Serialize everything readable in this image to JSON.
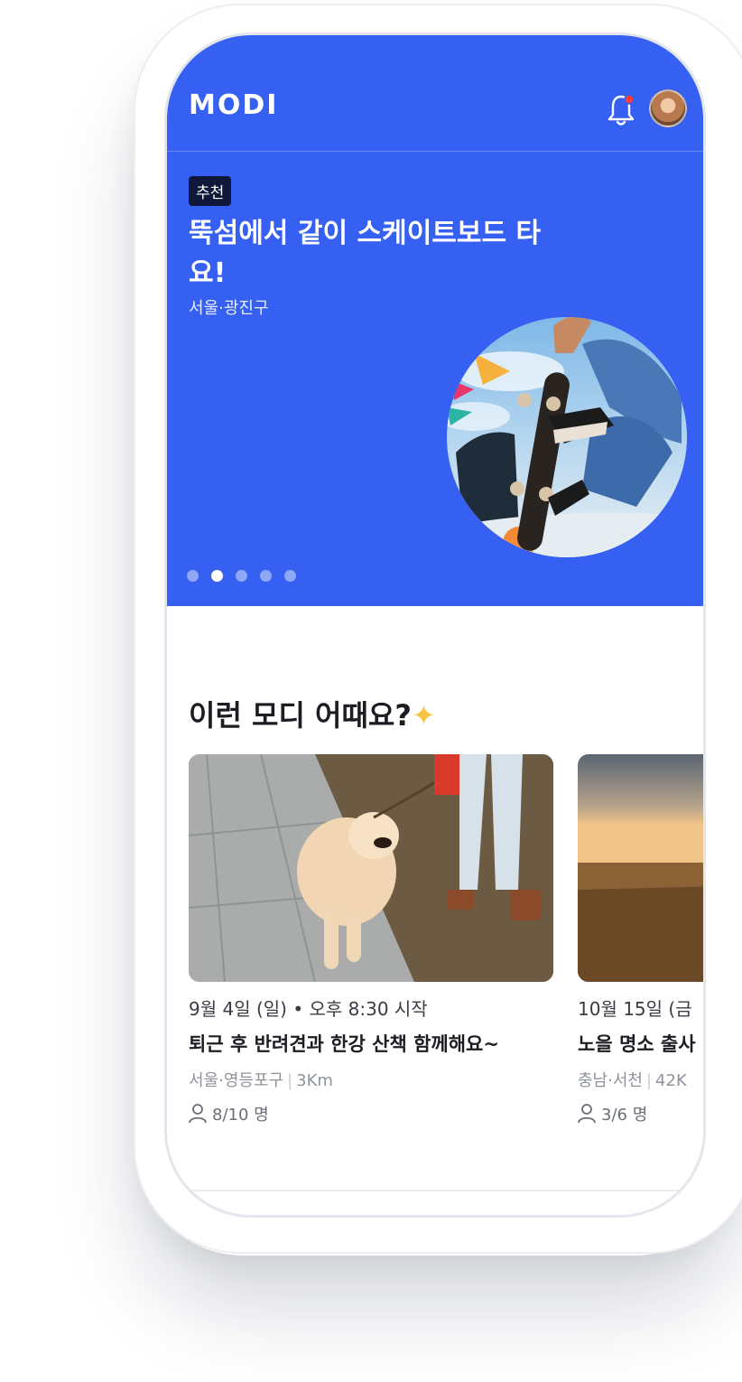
{
  "app": {
    "logo": "MODI"
  },
  "hero": {
    "tag": "추천",
    "title": "뚝섬에서 같이 스케이트보드 타요!",
    "location": "서울·광진구",
    "photo_icon": "skateboard-photo",
    "slides": 5,
    "active_slide": 2
  },
  "section": {
    "title": "이런 모디 어때요?",
    "title_icon": "star-icon"
  },
  "cards": [
    {
      "date": "9월 4일 (일) • 오후 8:30 시작",
      "title": "퇴근 후 반려견과 한강 산책 함께해요~",
      "location": "서울·영등포구",
      "distance": "3Km",
      "people": "8/10 명"
    },
    {
      "date": "10월 15일 (금",
      "title": "노을 명소 출사",
      "location": "충남·서천",
      "distance": "42K",
      "people": "3/6 명"
    }
  ],
  "colors": {
    "brand": "#3560f1",
    "tag_bg": "#0f1838",
    "notification": "#ff3b3b"
  }
}
